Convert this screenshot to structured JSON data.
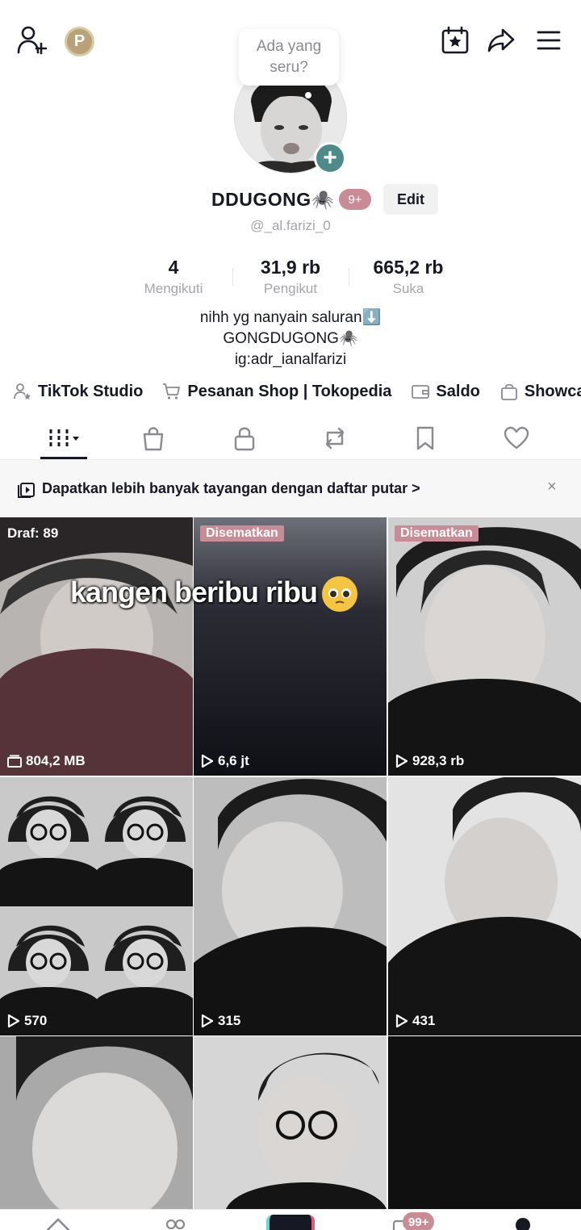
{
  "header": {
    "add_friend_icon": "person-plus-icon",
    "coin_label": "P",
    "bubble_line1": "Ada yang",
    "bubble_line2": "seru?",
    "calendar_icon": "calendar-star-icon",
    "share_icon": "share-icon",
    "menu_icon": "hamburger-menu-icon"
  },
  "profile": {
    "display_name": "DDUGONG🕷️",
    "notification_badge": "9+",
    "edit_label": "Edit",
    "handle": "@_al.farizi_0"
  },
  "stats": [
    {
      "value": "4",
      "label": "Mengikuti"
    },
    {
      "value": "31,9 rb",
      "label": "Pengikut"
    },
    {
      "value": "665,2 rb",
      "label": "Suka"
    }
  ],
  "bio": {
    "line1": "nihh yg nanyain saluran⬇️",
    "line2": "GONGDUGONG🕷️",
    "line3": "ig:adr_ianalfarizi"
  },
  "links": [
    {
      "icon": "person-star-icon",
      "label": "TikTok Studio"
    },
    {
      "icon": "cart-icon",
      "label": "Pesanan Shop | Tokopedia"
    },
    {
      "icon": "wallet-icon",
      "label": "Saldo"
    },
    {
      "icon": "bag-icon",
      "label": "Showca"
    }
  ],
  "tabs": [
    "videos-grid-icon",
    "shop-bag-icon",
    "lock-icon",
    "repost-icon",
    "bookmark-icon",
    "heart-icon"
  ],
  "banner": {
    "text": "Dapatkan lebih banyak tayangan dengan daftar putar >",
    "close": "×"
  },
  "videos": [
    {
      "top_label": "Draf: 89",
      "pinned": "",
      "stat": "804,2 MB",
      "stat_icon": "drafts-icon"
    },
    {
      "top_label": "",
      "pinned": "Disematkan",
      "stat": "6,6 jt",
      "stat_icon": "play-icon"
    },
    {
      "top_label": "",
      "pinned": "Disematkan",
      "stat": "928,3 rb",
      "stat_icon": "play-icon"
    },
    {
      "top_label": "",
      "pinned": "",
      "stat": "570",
      "stat_icon": "play-icon"
    },
    {
      "top_label": "",
      "pinned": "",
      "stat": "315",
      "stat_icon": "play-icon"
    },
    {
      "top_label": "",
      "pinned": "",
      "stat": "431",
      "stat_icon": "play-icon"
    },
    {
      "top_label": "",
      "pinned": "",
      "stat": "",
      "stat_icon": ""
    },
    {
      "top_label": "",
      "pinned": "",
      "stat": "",
      "stat_icon": ""
    },
    {
      "top_label": "",
      "pinned": "",
      "stat": "",
      "stat_icon": ""
    }
  ],
  "caption": "kangen beribu ribu",
  "navbar": {
    "inbox_badge": "99+"
  },
  "colors": {
    "accent_pink": "#c98b95",
    "avatar_plus": "#4f8a8b"
  }
}
